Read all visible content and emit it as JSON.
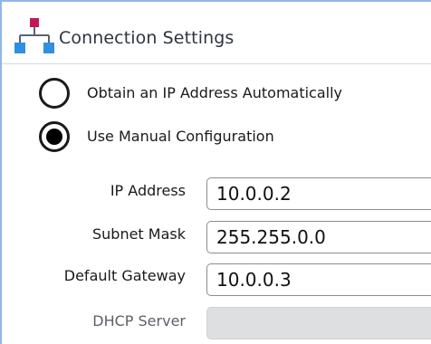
{
  "header": {
    "title": "Connection Settings",
    "icon": "network-icon"
  },
  "radios": {
    "auto": {
      "label": "Obtain an IP Address Automatically",
      "selected": false
    },
    "manual": {
      "label": "Use Manual Configuration",
      "selected": true
    }
  },
  "fields": {
    "ip_address": {
      "label": "IP Address",
      "value": "10.0.0.2"
    },
    "subnet_mask": {
      "label": "Subnet Mask",
      "value": "255.255.0.0"
    },
    "default_gateway": {
      "label": "Default Gateway",
      "value": "10.0.0.3"
    },
    "dhcp_server": {
      "label": "DHCP Server",
      "value": "",
      "disabled": true
    }
  },
  "colors": {
    "icon_top": "#c2185b",
    "icon_bottom": "#2f8fe0",
    "icon_lines": "#5a6470",
    "panel_border": "#8fb7e6",
    "disabled_field": "#dedfe1"
  }
}
